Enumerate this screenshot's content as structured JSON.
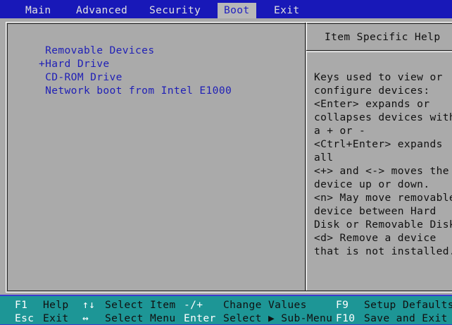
{
  "menu": {
    "tabs": [
      {
        "label": "Main"
      },
      {
        "label": "Advanced"
      },
      {
        "label": "Security"
      },
      {
        "label": "Boot"
      },
      {
        "label": "Exit"
      }
    ]
  },
  "boot": {
    "items": [
      {
        "label": " Removable Devices"
      },
      {
        "label": "+Hard Drive"
      },
      {
        "label": " CD-ROM Drive"
      },
      {
        "label": " Network boot from Intel E1000"
      }
    ]
  },
  "help": {
    "title": "Item Specific Help",
    "lines": [
      "Keys used to view or",
      "configure devices:",
      "<Enter> expands or",
      "collapses devices with",
      "a + or -",
      "<Ctrl+Enter> expands",
      "all",
      "<+> and <-> moves the",
      "device up or down.",
      "<n> May move removable",
      "device between Hard",
      "Disk or Removable Disk",
      "<d> Remove a device",
      "that is not installed."
    ]
  },
  "footer": {
    "row1": {
      "k1": "F1",
      "d1": "Help",
      "k2": "↑↓",
      "d2": "Select Item",
      "k3": "-/+",
      "d3": "Change Values",
      "k4": "F9",
      "d4": "Setup Defaults"
    },
    "row2": {
      "k1": "Esc",
      "d1": "Exit",
      "k2": "↔",
      "d2": "Select Menu",
      "k3": "Enter",
      "d3": "Select ▶ Sub-Menu",
      "k4": "F10",
      "d4": "Save and Exit"
    }
  },
  "colors": {
    "menubar": "#1818b8",
    "panel": "#aaaaaa",
    "footer": "#1d9696",
    "boot_item_text": "#1f1fb6"
  }
}
